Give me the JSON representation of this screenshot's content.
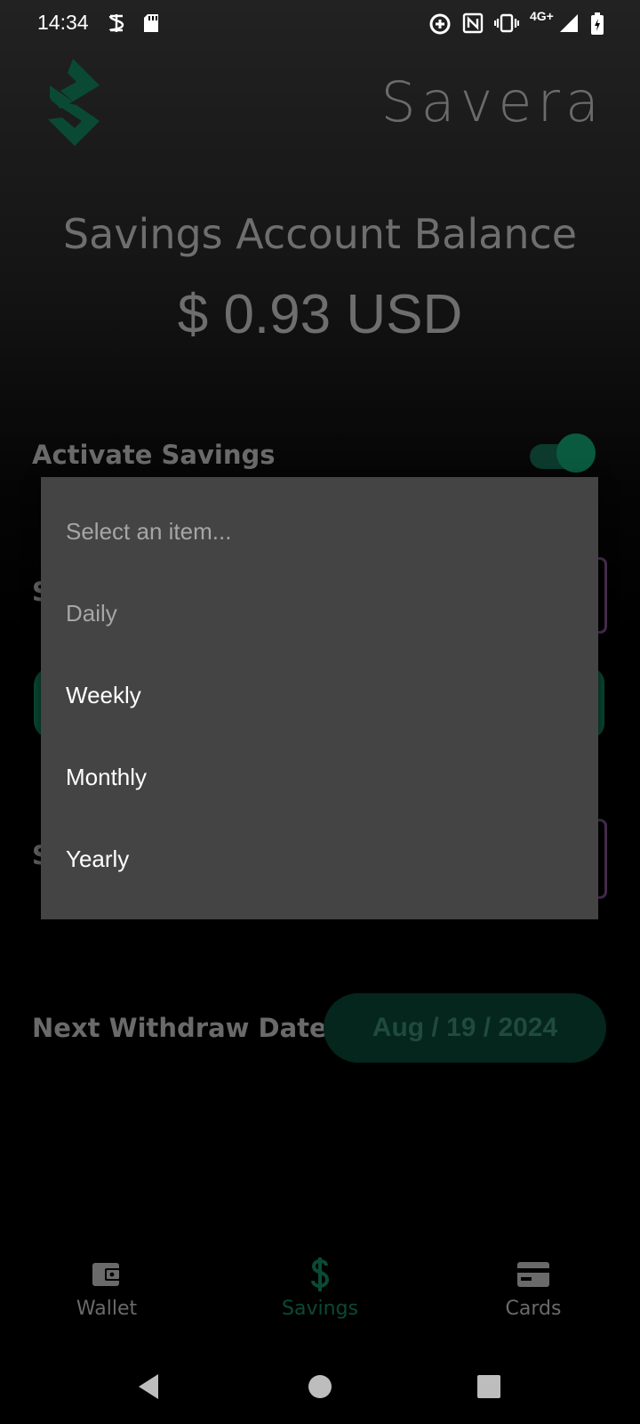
{
  "status_bar": {
    "time": "14:34",
    "network": "4G+",
    "icons": [
      "vpn-key-icon",
      "sd-card-icon",
      "data-saver-icon",
      "nfc-icon",
      "vibrate-icon",
      "signal-icon",
      "battery-charging-icon"
    ]
  },
  "header": {
    "brand": "Savera",
    "logo_icon": "savera-logo-icon"
  },
  "balance": {
    "title": "Savings Account Balance",
    "amount": "$ 0.93 USD"
  },
  "activate": {
    "label": "Activate Savings",
    "enabled": true
  },
  "withdraw": {
    "label": "Next Withdraw Date",
    "date": "Aug / 19 / 2024"
  },
  "dropdown": {
    "items": [
      {
        "label": "Select an item...",
        "enabled": false
      },
      {
        "label": "Daily",
        "enabled": false
      },
      {
        "label": "Weekly",
        "enabled": true
      },
      {
        "label": "Monthly",
        "enabled": true
      },
      {
        "label": "Yearly",
        "enabled": true
      }
    ]
  },
  "bottom_nav": {
    "items": [
      {
        "label": "Wallet",
        "icon": "wallet-icon",
        "active": false
      },
      {
        "label": "Savings",
        "icon": "dollar-icon",
        "active": true
      },
      {
        "label": "Cards",
        "icon": "credit-card-icon",
        "active": false
      }
    ]
  },
  "colors": {
    "accent": "#0a5a40",
    "dim_text": "#6e6e6e",
    "dropdown_bg": "#444444"
  }
}
